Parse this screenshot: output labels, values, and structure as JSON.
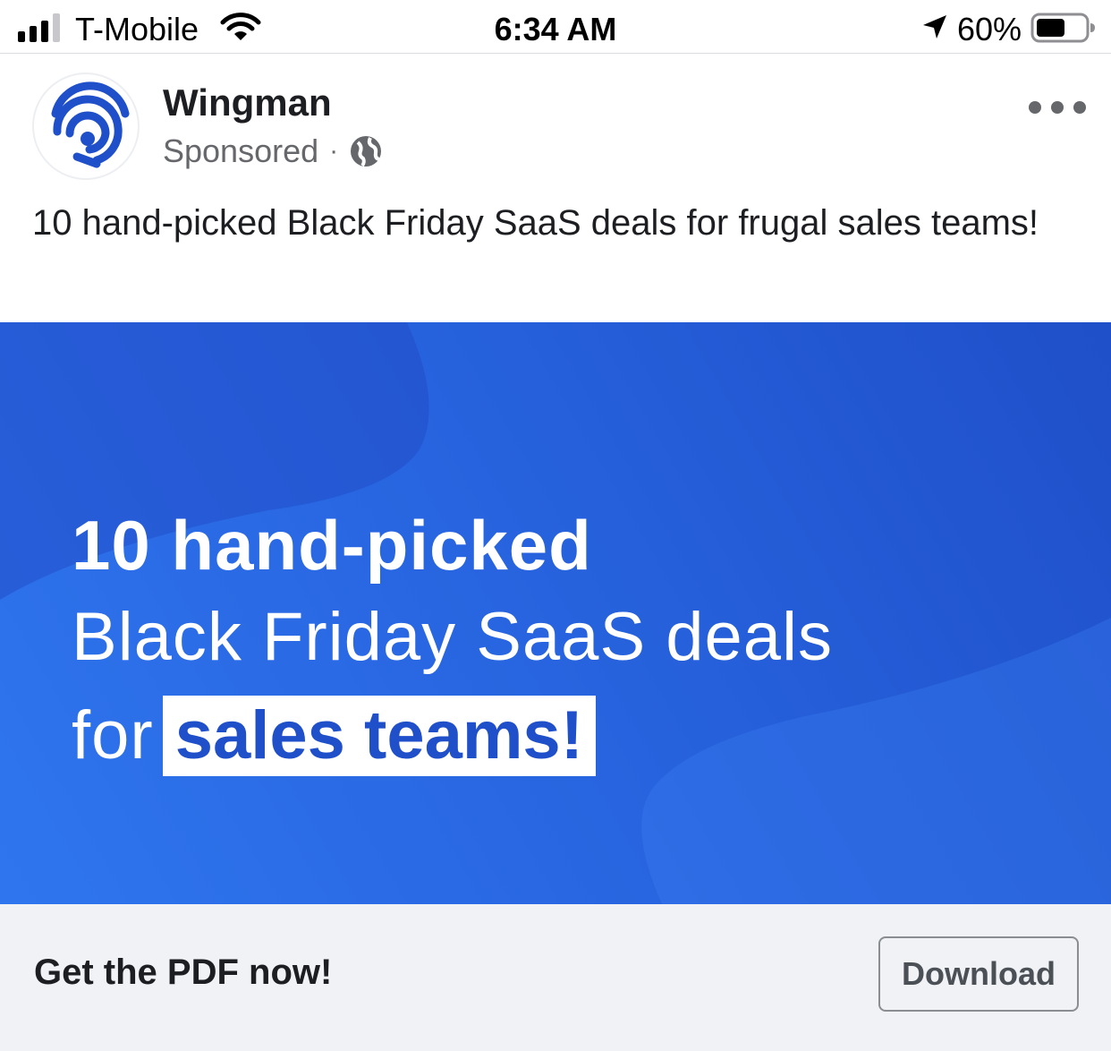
{
  "status_bar": {
    "carrier": "T-Mobile",
    "time": "6:34 AM",
    "battery_percent": "60%",
    "battery_level": 0.6,
    "signal_bars": 3,
    "icons": [
      "signal-icon",
      "wifi-icon",
      "location-arrow-icon",
      "battery-icon"
    ]
  },
  "post": {
    "page_name": "Wingman",
    "sponsored_label": "Sponsored",
    "separator": "·",
    "audience_icon": "globe-icon",
    "more_icon": "more-options-icon",
    "text": "10 hand-picked Black Friday SaaS deals for frugal sales teams!"
  },
  "creative": {
    "line1": "10 hand-picked",
    "line2": "Black Friday SaaS deals",
    "line3_prefix": "for",
    "line3_highlight": "sales teams!",
    "colors": {
      "background": "#2865e0",
      "highlight_bg": "#ffffff",
      "highlight_text": "#1f4fc9",
      "brand_logo": "#1f4fc9"
    }
  },
  "cta": {
    "text": "Get the PDF now!",
    "button_label": "Download"
  }
}
